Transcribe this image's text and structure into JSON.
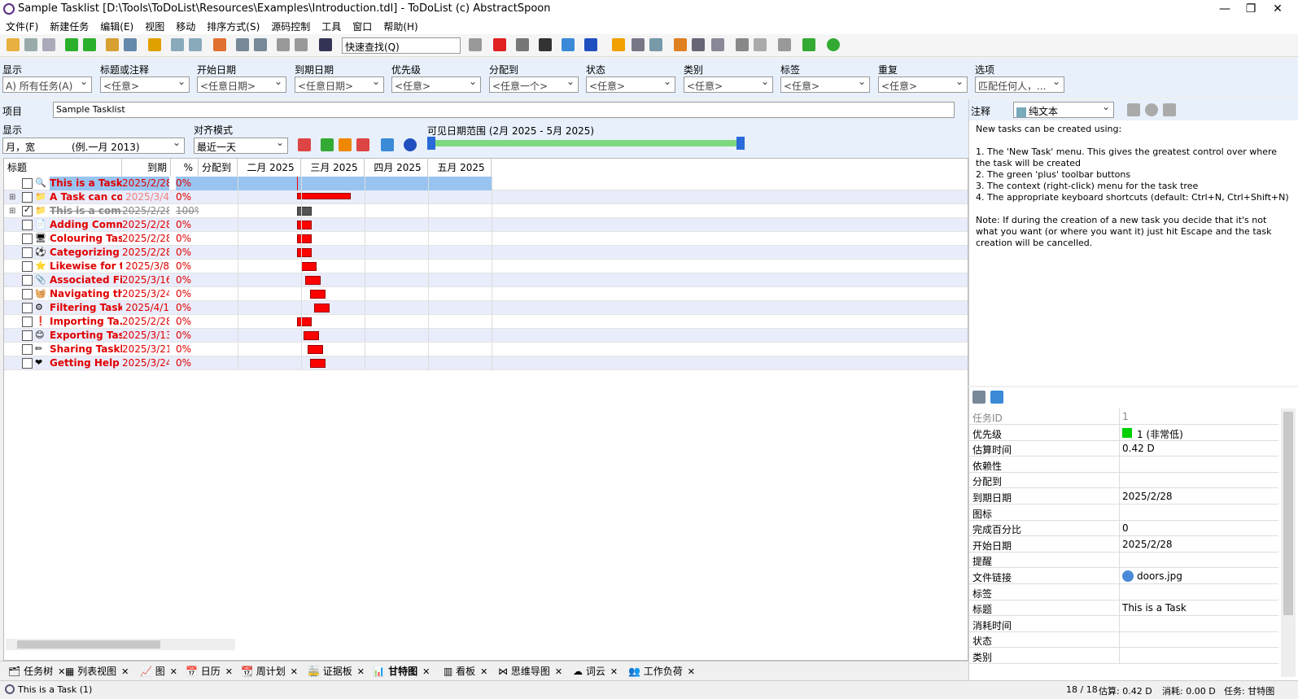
{
  "window": {
    "title": "Sample Tasklist [D:\\Tools\\ToDoList\\Resources\\Examples\\Introduction.tdl] - ToDoList (c) AbstractSpoon",
    "min": "—",
    "restore": "❐",
    "close": "✕"
  },
  "menu": [
    "文件(F)",
    "新建任务",
    "编辑(E)",
    "视图",
    "移动",
    "排序方式(S)",
    "源码控制",
    "工具",
    "窗口",
    "帮助(H)"
  ],
  "toolbar": {
    "quickfind": "快速查找(Q)"
  },
  "filters": [
    {
      "label": "显示",
      "value": "A)  所有任务(A)"
    },
    {
      "label": "标题或注释",
      "value": "<任意>"
    },
    {
      "label": "开始日期",
      "value": "<任意日期>"
    },
    {
      "label": "到期日期",
      "value": "<任意日期>"
    },
    {
      "label": "优先级",
      "value": "<任意>"
    },
    {
      "label": "分配到",
      "value": "<任意一个>"
    },
    {
      "label": "状态",
      "value": "<任意>"
    },
    {
      "label": "类别",
      "value": "<任意>"
    },
    {
      "label": "标签",
      "value": "<任意>"
    },
    {
      "label": "重复",
      "value": "<任意>"
    },
    {
      "label": "选项",
      "value": "匹配任何人，..."
    }
  ],
  "project": {
    "label": "项目",
    "value": "Sample Tasklist"
  },
  "gantt": {
    "display_label": "显示",
    "display_value": "月，宽",
    "display_example": "(例.一月 2013)",
    "snap_label": "对齐模式",
    "snap_value": "最近一天",
    "range_label": "可见日期范围 (2月 2025 - 5月 2025)"
  },
  "columns": {
    "title": "标题",
    "due": "到期",
    "pct": "%",
    "alloc": "分配到",
    "months": [
      "二月 2025",
      "三月 2025",
      "四月 2025",
      "五月 2025"
    ]
  },
  "tasks": [
    {
      "title": "This is a Task",
      "due": "2025/2/28",
      "pct": "0%",
      "style": "selected",
      "start": 28,
      "len": 0
    },
    {
      "title": "A Task can co...",
      "due": "2025/3/4",
      "pct": "0%",
      "style": "parent",
      "start": 28,
      "len": 5
    },
    {
      "title": "This is a com...",
      "due": "2025/2/28",
      "pct": "100%",
      "style": "done",
      "start": 28,
      "len": 2
    },
    {
      "title": "Adding Comm...",
      "due": "2025/2/28",
      "pct": "0%",
      "style": "normal",
      "start": 28,
      "len": 2
    },
    {
      "title": "Colouring Tas...",
      "due": "2025/2/28",
      "pct": "0%",
      "style": "normal",
      "start": 28,
      "len": 2
    },
    {
      "title": "Categorizing ...",
      "due": "2025/2/28",
      "pct": "0%",
      "style": "normal",
      "start": 28,
      "len": 2
    },
    {
      "title": "Likewise for t...",
      "due": "2025/3/8",
      "pct": "0%",
      "style": "normal",
      "start": 30,
      "len": 2
    },
    {
      "title": "Associated Fil...",
      "due": "2025/3/16",
      "pct": "0%",
      "style": "normal",
      "start": 32,
      "len": 2
    },
    {
      "title": "Navigating th...",
      "due": "2025/3/24",
      "pct": "0%",
      "style": "normal",
      "start": 34,
      "len": 2
    },
    {
      "title": "Filtering Tasks",
      "due": "2025/4/1",
      "pct": "0%",
      "style": "normal",
      "start": 36,
      "len": 2
    },
    {
      "title": "Importing Ta...",
      "due": "2025/2/28",
      "pct": "0%",
      "style": "normal",
      "start": 28,
      "len": 2
    },
    {
      "title": "Exporting Tas...",
      "due": "2025/3/13",
      "pct": "0%",
      "style": "normal",
      "start": 31,
      "len": 2
    },
    {
      "title": "Sharing Taskl...",
      "due": "2025/3/21",
      "pct": "0%",
      "style": "normal",
      "start": 33,
      "len": 2
    },
    {
      "title": "Getting Help",
      "due": "2025/3/24",
      "pct": "0%",
      "style": "normal",
      "start": 34,
      "len": 2
    }
  ],
  "tabs": [
    "任务树",
    "列表视图",
    "图",
    "日历",
    "周计划",
    "证据板",
    "甘特图",
    "看板",
    "思维导图",
    "词云",
    "工作负荷"
  ],
  "notes": {
    "label": "注释",
    "format": "纯文本",
    "text": "New tasks can be created using:\n\n1. The 'New Task' menu. This gives the greatest control over where the task will be created\n2. The green 'plus' toolbar buttons\n3. The context (right-click) menu for the task tree\n4. The appropriate keyboard shortcuts (default: Ctrl+N, Ctrl+Shift+N)\n\nNote: If during the creation of a new task you decide that it's not what you want (or where you want it) just hit Escape and the task creation will be cancelled."
  },
  "props": [
    {
      "label": "任务ID",
      "value": "1"
    },
    {
      "label": "优先级",
      "value": "1 (非常低)"
    },
    {
      "label": "估算时间",
      "value": "0.42 D"
    },
    {
      "label": "依赖性",
      "value": ""
    },
    {
      "label": "分配到",
      "value": ""
    },
    {
      "label": "到期日期",
      "value": "2025/2/28"
    },
    {
      "label": "图标",
      "value": ""
    },
    {
      "label": "完成百分比",
      "value": "0"
    },
    {
      "label": "开始日期",
      "value": "2025/2/28"
    },
    {
      "label": "提醒",
      "value": ""
    },
    {
      "label": "文件链接",
      "value": "doors.jpg"
    },
    {
      "label": "标签",
      "value": ""
    },
    {
      "label": "标题",
      "value": "This is a Task"
    },
    {
      "label": "消耗时间",
      "value": ""
    },
    {
      "label": "状态",
      "value": ""
    },
    {
      "label": "类别",
      "value": ""
    }
  ],
  "status": {
    "left": "This is a Task  (1)",
    "count": "18 / 18",
    "est": "估算: 0.42 D",
    "spent": "消耗: 0.00 D",
    "view": "任务: 甘特图"
  },
  "colors": {
    "red": "#e00000",
    "selected": "#99c4f0",
    "priority_low": "#00d000"
  }
}
